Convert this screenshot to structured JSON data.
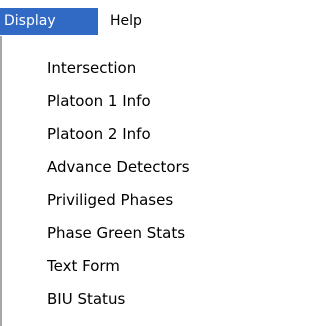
{
  "menubar": {
    "items": [
      {
        "label": "Display",
        "active": true
      },
      {
        "label": "Help",
        "active": false
      }
    ]
  },
  "dropdown": {
    "items": [
      {
        "label": "Intersection"
      },
      {
        "label": "Platoon 1 Info"
      },
      {
        "label": "Platoon 2 Info"
      },
      {
        "label": "Advance Detectors"
      },
      {
        "label": "Priviliged Phases"
      },
      {
        "label": "Phase Green Stats"
      },
      {
        "label": "Text Form"
      },
      {
        "label": "BIU Status"
      }
    ]
  },
  "colors": {
    "highlight": "#316ac5",
    "highlight_text": "#ffffff",
    "menu_border": "#a7a6aa"
  }
}
